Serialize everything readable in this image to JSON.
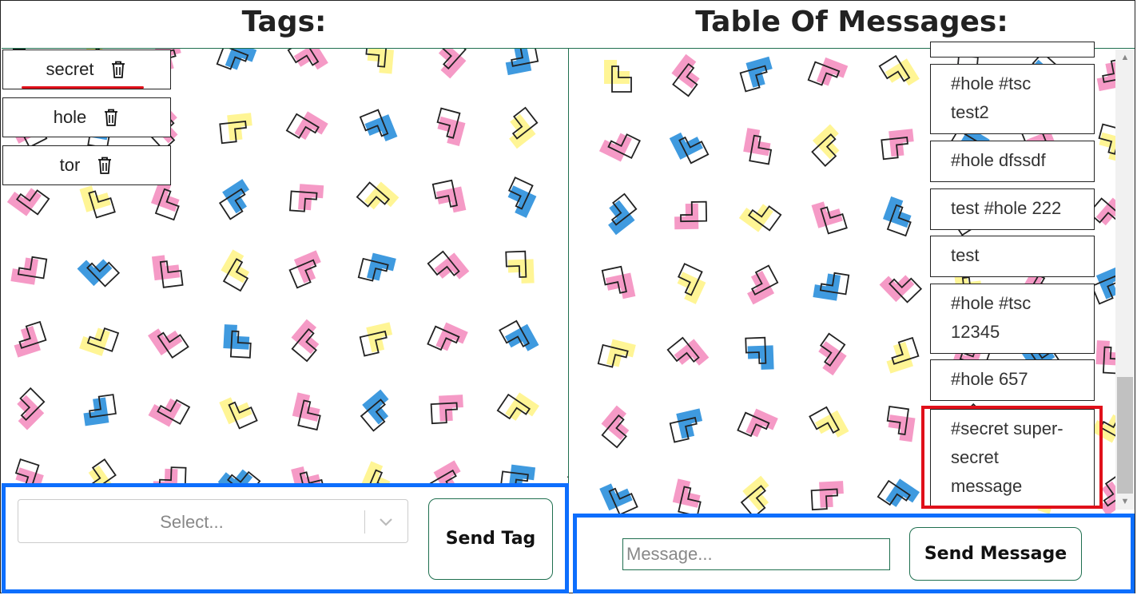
{
  "headers": {
    "tags_title": "Tags:",
    "messages_title": "Table Of Messages:"
  },
  "tags": [
    {
      "label": "secret",
      "delete_icon": "trash-icon",
      "selected": true
    },
    {
      "label": "hole",
      "delete_icon": "trash-icon"
    },
    {
      "label": "tor",
      "delete_icon": "trash-icon"
    }
  ],
  "messages": [
    {
      "text": "#hole #tsc test2"
    },
    {
      "text": "#hole dfssdf"
    },
    {
      "text": "test #hole 222"
    },
    {
      "text": "test"
    },
    {
      "text": "#hole #tsc 12345"
    },
    {
      "text": "#hole 657"
    },
    {
      "text": "#secret super-secret message",
      "highlighted": true
    }
  ],
  "tag_form": {
    "select_placeholder": "Select...",
    "send_label": "Send Tag"
  },
  "message_form": {
    "input_placeholder": "Message...",
    "send_label": "Send Message"
  },
  "colors": {
    "form_border": "#0d6efd",
    "highlight": "#e0101a",
    "divider": "#1f6f4f",
    "pattern_pink": "#f48fc0",
    "pattern_blue": "#2a8fdc",
    "pattern_yellow": "#fff48a"
  }
}
